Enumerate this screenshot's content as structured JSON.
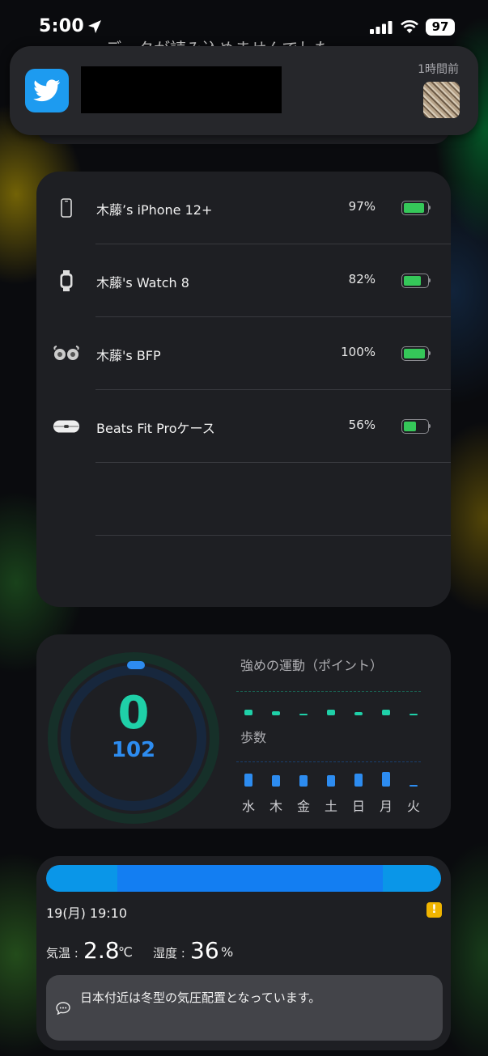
{
  "status_bar": {
    "time": "5:00",
    "battery_level": "97",
    "location_icon": "location-arrow-icon",
    "signal_icon": "cellular-signal-icon",
    "wifi_icon": "wifi-icon"
  },
  "background_widget": {
    "text": "データが読み込めませんでした"
  },
  "notification": {
    "app_icon": "twitter-bird-icon",
    "time_ago": "1時間前",
    "accent_color": "#1d9bf0"
  },
  "batteries": {
    "devices": [
      {
        "name": "木藤’s iPhone 12+",
        "percent": "97%",
        "level": 0.97,
        "icon": "iphone-icon"
      },
      {
        "name": "木藤's Watch 8",
        "percent": "82%",
        "level": 0.82,
        "icon": "apple-watch-icon"
      },
      {
        "name": "木藤's BFP",
        "percent": "100%",
        "level": 1.0,
        "icon": "earbuds-icon"
      },
      {
        "name": "Beats Fit Proケース",
        "percent": "56%",
        "level": 0.56,
        "icon": "earbuds-case-icon"
      }
    ],
    "fill_color": "#35c759"
  },
  "fitness": {
    "move_points": "0",
    "steps": "102",
    "intense_label": "強めの運動（ポイント）",
    "steps_label": "歩数",
    "days": [
      "水",
      "木",
      "金",
      "土",
      "日",
      "月",
      "火"
    ],
    "intense_levels": [
      0.55,
      0.4,
      0.05,
      0.6,
      0.35,
      0.55,
      0
    ],
    "steps_levels": [
      0.8,
      0.7,
      0.7,
      0.68,
      0.78,
      0.9,
      0.06
    ],
    "intense_color": "#1fd0a8",
    "steps_color": "#2d8cf0"
  },
  "weather": {
    "datetime": "19(月) 19:10",
    "warning_mark": "!",
    "temp_label": "気温 :",
    "temp_value": "2.8",
    "temp_unit": "℃",
    "humidity_label": "湿度 :",
    "humidity_value": "36",
    "humidity_unit": "%",
    "message": "日本付近は冬型の気圧配置となっています。",
    "message_icon": "speech-bubble-icon"
  }
}
